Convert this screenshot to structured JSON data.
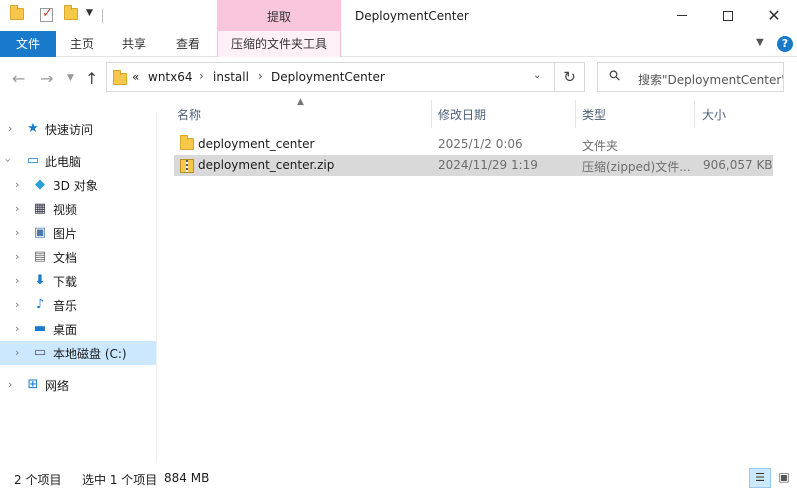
{
  "window": {
    "title": "DeploymentCenter",
    "context_tab_header": "提取"
  },
  "ribbon": {
    "tabs": [
      {
        "label": "文件"
      },
      {
        "label": "主页"
      },
      {
        "label": "共享"
      },
      {
        "label": "查看"
      },
      {
        "label": "压缩的文件夹工具"
      }
    ],
    "help_label": "?"
  },
  "address": {
    "overflow": "«",
    "crumbs": [
      "wntx64",
      "install",
      "DeploymentCenter"
    ]
  },
  "search": {
    "placeholder": "搜索\"DeploymentCenter\""
  },
  "sidebar": {
    "items": [
      {
        "label": "快速访问",
        "icon": "star-icon"
      },
      {
        "label": "此电脑",
        "icon": "computer-icon"
      },
      {
        "label": "3D 对象",
        "icon": "cube-icon"
      },
      {
        "label": "视频",
        "icon": "film-icon"
      },
      {
        "label": "图片",
        "icon": "picture-icon"
      },
      {
        "label": "文档",
        "icon": "document-icon"
      },
      {
        "label": "下载",
        "icon": "download-icon"
      },
      {
        "label": "音乐",
        "icon": "music-icon"
      },
      {
        "label": "桌面",
        "icon": "desktop-icon"
      },
      {
        "label": "本地磁盘 (C:)",
        "icon": "drive-icon"
      },
      {
        "label": "网络",
        "icon": "network-icon"
      }
    ]
  },
  "columns": {
    "name": "名称",
    "modified": "修改日期",
    "type": "类型",
    "size": "大小"
  },
  "files": [
    {
      "name": "deployment_center",
      "modified": "2025/1/2 0:06",
      "type": "文件夹",
      "size": ""
    },
    {
      "name": "deployment_center.zip",
      "modified": "2024/11/29 1:19",
      "type": "压缩(zipped)文件...",
      "size": "906,057 KB"
    }
  ],
  "status": {
    "count": "2 个项目",
    "selected": "选中 1 个项目",
    "selected_size": "884 MB"
  },
  "colors": {
    "accent": "#1979ca",
    "context_tab": "#f9c6dc",
    "selection": "#cce8ff"
  }
}
